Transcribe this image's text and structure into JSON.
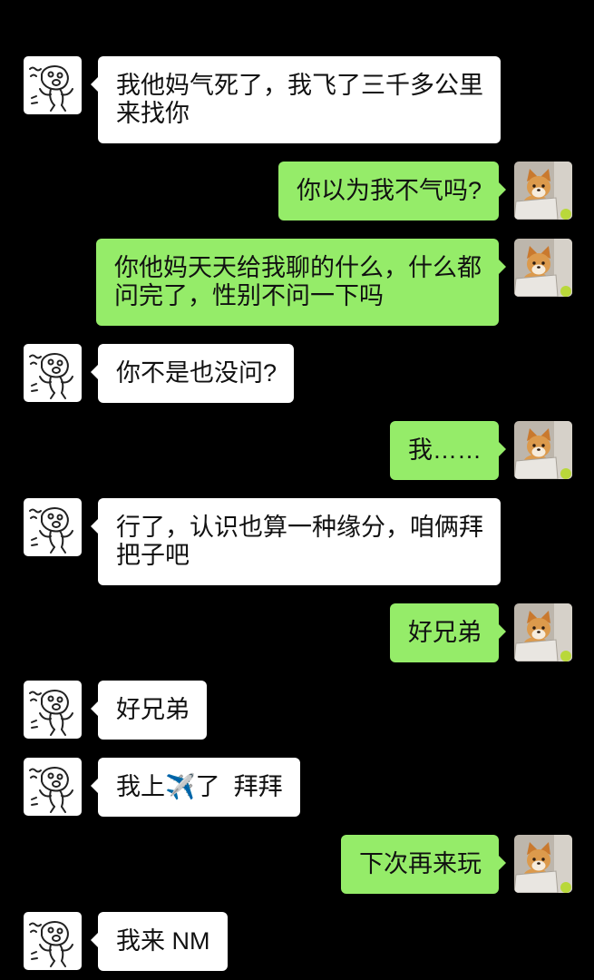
{
  "chat": {
    "theme": {
      "background": "#000000",
      "incoming_bubble": "#ffffff",
      "outgoing_bubble": "#95ec69",
      "text": "#111111",
      "emoji_color": "#4a9fe0"
    },
    "incoming_avatar_icon": "sketch-doodle-avatar",
    "outgoing_avatar_icon": "shiba-dog-avatar",
    "messages": [
      {
        "lines": [
          "我他妈气死了，我飞了三千多公里",
          "来找你"
        ]
      },
      {
        "lines": [
          "你以为我不气吗?"
        ]
      },
      {
        "lines": [
          "你他妈天天给我聊的什么，什么都",
          "问完了，性别不问一下吗"
        ]
      },
      {
        "lines": [
          "你不是也没问?"
        ]
      },
      {
        "lines": [
          "我……"
        ]
      },
      {
        "lines": [
          "行了，认识也算一种缘分，咱俩拜",
          "把子吧"
        ]
      },
      {
        "lines": [
          "好兄弟"
        ]
      },
      {
        "lines": [
          "好兄弟"
        ]
      },
      {
        "segments": [
          "我上",
          "✈️",
          "了  拜拜"
        ]
      },
      {
        "lines": [
          "下次再来玩"
        ]
      },
      {
        "lines": [
          "我来 NM"
        ]
      }
    ]
  }
}
